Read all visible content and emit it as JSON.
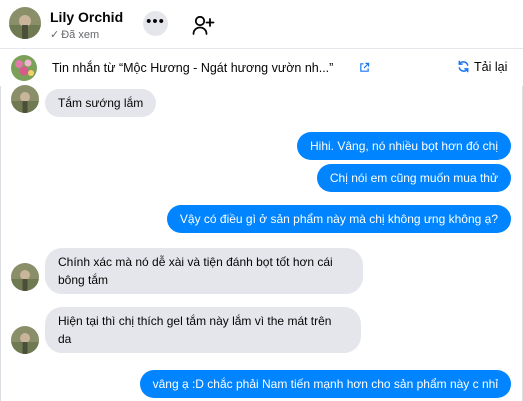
{
  "header": {
    "contact_name": "Lily Orchid",
    "seen_status": "Đã xem",
    "more_label": "•••"
  },
  "forwarded_bar": {
    "text": "Tin nhắn từ  “Mộc Hương - Ngát hương vườn nh...”",
    "reload_label": "Tải lại"
  },
  "messages": [
    {
      "direction": "in",
      "text": "Tắm sướng lắm"
    },
    {
      "direction": "out",
      "text": "Hihi. Vâng, nó nhiều bọt hơn đó chị"
    },
    {
      "direction": "out",
      "text": "Chị nói em cũng muốn mua thử"
    },
    {
      "direction": "out",
      "text": "Vậy có điều gì ở sản phẩm này mà chị không ưng không ạ?"
    },
    {
      "direction": "in",
      "text": "Chính xác mà nó dễ xài và tiện đánh bọt tốt hơn cái bông tắm"
    },
    {
      "direction": "in",
      "text": "Hiện tại thì chị thích gel tắm này lắm vì the mát trên da"
    },
    {
      "direction": "out",
      "text": "vâng ạ :D chắc phải Nam tiến mạnh hơn cho sản phẩm này c nhỉ"
    }
  ],
  "colors": {
    "outgoing_bubble": "#0084ff",
    "incoming_bubble": "#e4e6eb"
  },
  "icons": [
    "more-options-icon",
    "add-user-icon",
    "external-link-icon",
    "reload-icon",
    "check-icon"
  ]
}
